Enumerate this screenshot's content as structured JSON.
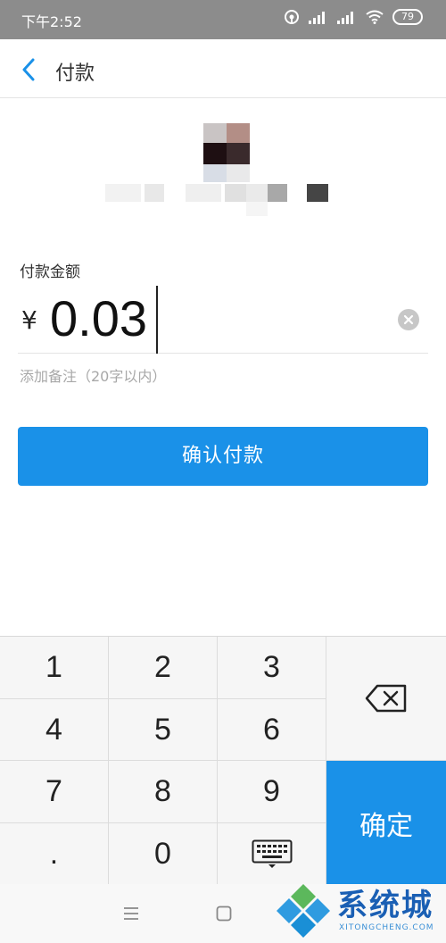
{
  "status_bar": {
    "time": "下午2:52",
    "battery": "79"
  },
  "nav": {
    "title": "付款"
  },
  "payment": {
    "amount_label": "付款金额",
    "currency": "¥",
    "amount": "0.03",
    "remark_placeholder": "添加备注（20字以内）",
    "confirm_label": "确认付款"
  },
  "keypad": {
    "keys": [
      "1",
      "2",
      "3",
      "4",
      "5",
      "6",
      "7",
      "8",
      "9",
      ".",
      "0"
    ],
    "ok_label": "确定"
  },
  "watermark": {
    "text": "系统城",
    "sub": "XITONGCHENG.COM"
  },
  "colors": {
    "accent": "#1a91e8",
    "status_bar": "#8c8c8c"
  }
}
